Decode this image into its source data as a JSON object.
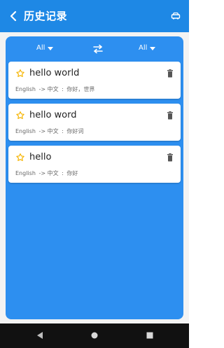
{
  "topbar": {
    "back_icon": "chevron-left-icon",
    "title": "历史记录",
    "action_icon": "car-icon"
  },
  "filters": {
    "from_language": "All",
    "to_language": "All",
    "swap_icon": "swap-icon"
  },
  "history": [
    {
      "word": "hello world",
      "source_language": "English",
      "arrow": "->",
      "target_language": "中文",
      "colon": ":",
      "translation": "你好，世界"
    },
    {
      "word": "hello word",
      "source_language": "English",
      "arrow": "->",
      "target_language": "中文",
      "colon": ":",
      "translation": "你好词"
    },
    {
      "word": "hello",
      "source_language": "English",
      "arrow": "->",
      "target_language": "中文",
      "colon": ":",
      "translation": "你好"
    }
  ],
  "navigation": {
    "back_icon": "nav-back-icon",
    "home_icon": "nav-home-icon",
    "recents_icon": "nav-recents-icon"
  },
  "colors": {
    "header": "#1e88e5",
    "panel": "#2d8ff0",
    "card": "#ffffff",
    "star": "#f6b400",
    "delete": "#555555",
    "navbar": "#111111"
  }
}
